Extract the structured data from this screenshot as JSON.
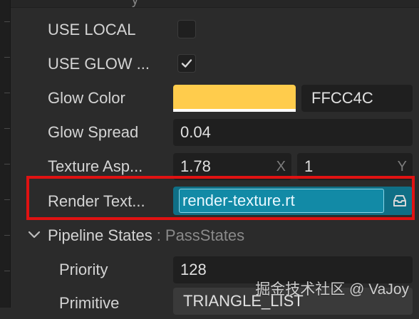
{
  "header": {
    "clipped_text": "y"
  },
  "properties": {
    "use_local": {
      "label": "USE LOCAL",
      "checked": false
    },
    "use_glow": {
      "label": "USE GLOW ...",
      "checked": true
    },
    "glow_color": {
      "label": "Glow Color",
      "hex": "FFCC4C",
      "swatch_color": "#ffcc4c"
    },
    "glow_spread": {
      "label": "Glow Spread",
      "value": "0.04"
    },
    "texture_aspect": {
      "label": "Texture Asp...",
      "x_value": "1.78",
      "x_axis": "X",
      "y_value": "1",
      "y_axis": "Y"
    },
    "render_texture": {
      "label": "Render Text...",
      "value": "render-texture.rt",
      "icon": "asset-picker-icon"
    }
  },
  "pipeline": {
    "title": "Pipeline States",
    "separator": ":",
    "type": "PassStates",
    "priority": {
      "label": "Priority",
      "value": "128"
    },
    "primitive": {
      "label": "Primitive",
      "value": "TRIANGLE_LIST"
    }
  },
  "overlay": {
    "watermark": "掘金技术社区 @ VaJoy"
  },
  "colors": {
    "panel_bg": "#2b2b2b",
    "field_bg": "#1f1f1f",
    "accent_blue": "#128aa6",
    "highlight_red": "#e01212",
    "glow_color": "#ffcc4c"
  }
}
